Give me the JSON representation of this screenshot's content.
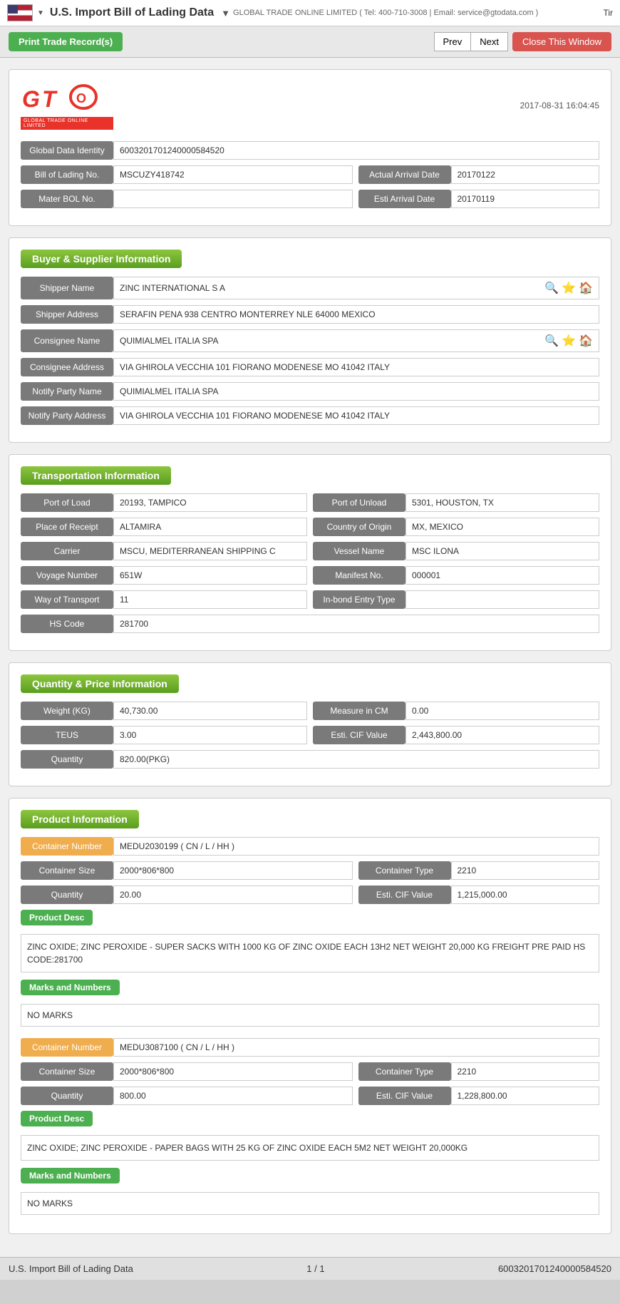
{
  "topbar": {
    "title": "U.S. Import Bill of Lading Data",
    "subtitle": "GLOBAL TRADE ONLINE LIMITED ( Tel: 400-710-3008 | Email: service@gtodata.com )",
    "right": "Tir"
  },
  "toolbar": {
    "print_label": "Print Trade Record(s)",
    "prev_label": "Prev",
    "next_label": "Next",
    "close_label": "Close This Window"
  },
  "record": {
    "timestamp": "2017-08-31 16:04:45",
    "global_data_identity_label": "Global Data Identity",
    "global_data_identity_value": "6003201701240000584520",
    "bol_label": "Bill of Lading No.",
    "bol_value": "MSCUZY418742",
    "actual_arrival_label": "Actual Arrival Date",
    "actual_arrival_value": "20170122",
    "mater_bol_label": "Mater BOL No.",
    "mater_bol_value": "",
    "esti_arrival_label": "Esti Arrival Date",
    "esti_arrival_value": "20170119"
  },
  "buyer_supplier": {
    "heading": "Buyer & Supplier Information",
    "shipper_name_label": "Shipper Name",
    "shipper_name_value": "ZINC INTERNATIONAL S A",
    "shipper_address_label": "Shipper Address",
    "shipper_address_value": "SERAFIN PENA 938 CENTRO MONTERREY NLE 64000 MEXICO",
    "consignee_name_label": "Consignee Name",
    "consignee_name_value": "QUIMIALMEL ITALIA SPA",
    "consignee_address_label": "Consignee Address",
    "consignee_address_value": "VIA GHIROLA VECCHIA 101 FIORANO MODENESE MO 41042 ITALY",
    "notify_party_name_label": "Notify Party Name",
    "notify_party_name_value": "QUIMIALMEL ITALIA SPA",
    "notify_party_address_label": "Notify Party Address",
    "notify_party_address_value": "VIA GHIROLA VECCHIA 101 FIORANO MODENESE MO 41042 ITALY"
  },
  "transportation": {
    "heading": "Transportation Information",
    "port_of_load_label": "Port of Load",
    "port_of_load_value": "20193, TAMPICO",
    "port_of_unload_label": "Port of Unload",
    "port_of_unload_value": "5301, HOUSTON, TX",
    "place_of_receipt_label": "Place of Receipt",
    "place_of_receipt_value": "ALTAMIRA",
    "country_of_origin_label": "Country of Origin",
    "country_of_origin_value": "MX, MEXICO",
    "carrier_label": "Carrier",
    "carrier_value": "MSCU, MEDITERRANEAN SHIPPING C",
    "vessel_name_label": "Vessel Name",
    "vessel_name_value": "MSC ILONA",
    "voyage_number_label": "Voyage Number",
    "voyage_number_value": "651W",
    "manifest_no_label": "Manifest No.",
    "manifest_no_value": "000001",
    "way_of_transport_label": "Way of Transport",
    "way_of_transport_value": "11",
    "inbond_entry_label": "In-bond Entry Type",
    "inbond_entry_value": "",
    "hs_code_label": "HS Code",
    "hs_code_value": "281700"
  },
  "quantity_price": {
    "heading": "Quantity & Price Information",
    "weight_label": "Weight (KG)",
    "weight_value": "40,730.00",
    "measure_label": "Measure in CM",
    "measure_value": "0.00",
    "teus_label": "TEUS",
    "teus_value": "3.00",
    "esti_cif_label": "Esti. CIF Value",
    "esti_cif_value": "2,443,800.00",
    "quantity_label": "Quantity",
    "quantity_value": "820.00(PKG)"
  },
  "product_info": {
    "heading": "Product Information",
    "containers": [
      {
        "container_number_label": "Container Number",
        "container_number_value": "MEDU2030199 ( CN / L / HH )",
        "container_size_label": "Container Size",
        "container_size_value": "2000*806*800",
        "container_type_label": "Container Type",
        "container_type_value": "2210",
        "quantity_label": "Quantity",
        "quantity_value": "20.00",
        "esti_cif_label": "Esti. CIF Value",
        "esti_cif_value": "1,215,000.00",
        "product_desc_label": "Product Desc",
        "product_desc_value": "ZINC OXIDE; ZINC PEROXIDE - SUPER SACKS WITH 1000 KG OF ZINC OXIDE EACH 13H2 NET WEIGHT 20,000 KG FREIGHT PRE PAID HS CODE:281700",
        "marks_label": "Marks and Numbers",
        "marks_value": "NO MARKS"
      },
      {
        "container_number_label": "Container Number",
        "container_number_value": "MEDU3087100 ( CN / L / HH )",
        "container_size_label": "Container Size",
        "container_size_value": "2000*806*800",
        "container_type_label": "Container Type",
        "container_type_value": "2210",
        "quantity_label": "Quantity",
        "quantity_value": "800.00",
        "esti_cif_label": "Esti. CIF Value",
        "esti_cif_value": "1,228,800.00",
        "product_desc_label": "Product Desc",
        "product_desc_value": "ZINC OXIDE; ZINC PEROXIDE - PAPER BAGS WITH 25 KG OF ZINC OXIDE EACH 5M2 NET WEIGHT 20,000KG",
        "marks_label": "Marks and Numbers",
        "marks_value": "NO MARKS"
      }
    ]
  },
  "footer": {
    "left": "U.S. Import Bill of Lading Data",
    "page": "1 / 1",
    "right": "6003201701240000584520"
  }
}
